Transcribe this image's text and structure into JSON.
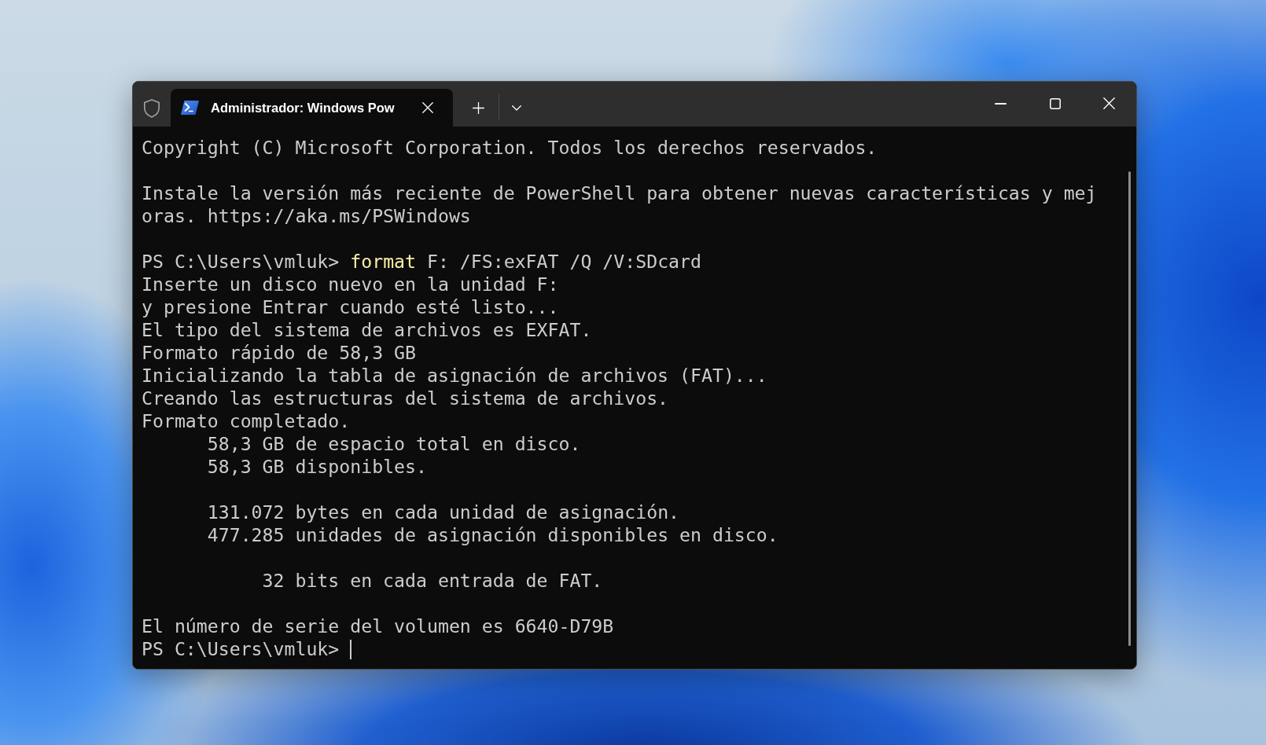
{
  "window": {
    "tabs": [
      {
        "title": "Administrador: Windows Pow",
        "selected": true
      }
    ]
  },
  "terminal": {
    "blocks": [
      {
        "lines": [
          {
            "kind": "output",
            "text": "Copyright (C) Microsoft Corporation. Todos los derechos reservados."
          }
        ]
      },
      {
        "lines": [
          {
            "kind": "output",
            "text": "Instale la versión más reciente de PowerShell para obtener nuevas características y mej"
          },
          {
            "kind": "output",
            "text": "oras. https://aka.ms/PSWindows"
          }
        ]
      },
      {
        "lines": [
          {
            "kind": "command",
            "prompt": "PS C:\\Users\\vmluk>",
            "command": "format",
            "args": "F: /FS:exFAT /Q /V:SDcard"
          },
          {
            "kind": "output",
            "text": "Inserte un disco nuevo en la unidad F:"
          },
          {
            "kind": "output",
            "text": "y presione Entrar cuando esté listo..."
          },
          {
            "kind": "output",
            "text": "El tipo del sistema de archivos es EXFAT."
          },
          {
            "kind": "output",
            "text": "Formato rápido de 58,3 GB"
          },
          {
            "kind": "output",
            "text": "Inicializando la tabla de asignación de archivos (FAT)..."
          },
          {
            "kind": "output",
            "text": "Creando las estructuras del sistema de archivos."
          },
          {
            "kind": "output",
            "text": "Formato completado."
          },
          {
            "kind": "output",
            "text": "      58,3 GB de espacio total en disco."
          },
          {
            "kind": "output",
            "text": "      58,3 GB disponibles."
          }
        ]
      },
      {
        "lines": [
          {
            "kind": "output",
            "text": "      131.072 bytes en cada unidad de asignación."
          },
          {
            "kind": "output",
            "text": "      477.285 unidades de asignación disponibles en disco."
          }
        ]
      },
      {
        "lines": [
          {
            "kind": "output",
            "text": "           32 bits en cada entrada de FAT."
          }
        ]
      },
      {
        "lines": [
          {
            "kind": "output",
            "text": "El número de serie del volumen es 6640-D79B"
          },
          {
            "kind": "prompt",
            "prompt": "PS C:\\Users\\vmluk>",
            "cursor": true
          }
        ]
      }
    ]
  }
}
